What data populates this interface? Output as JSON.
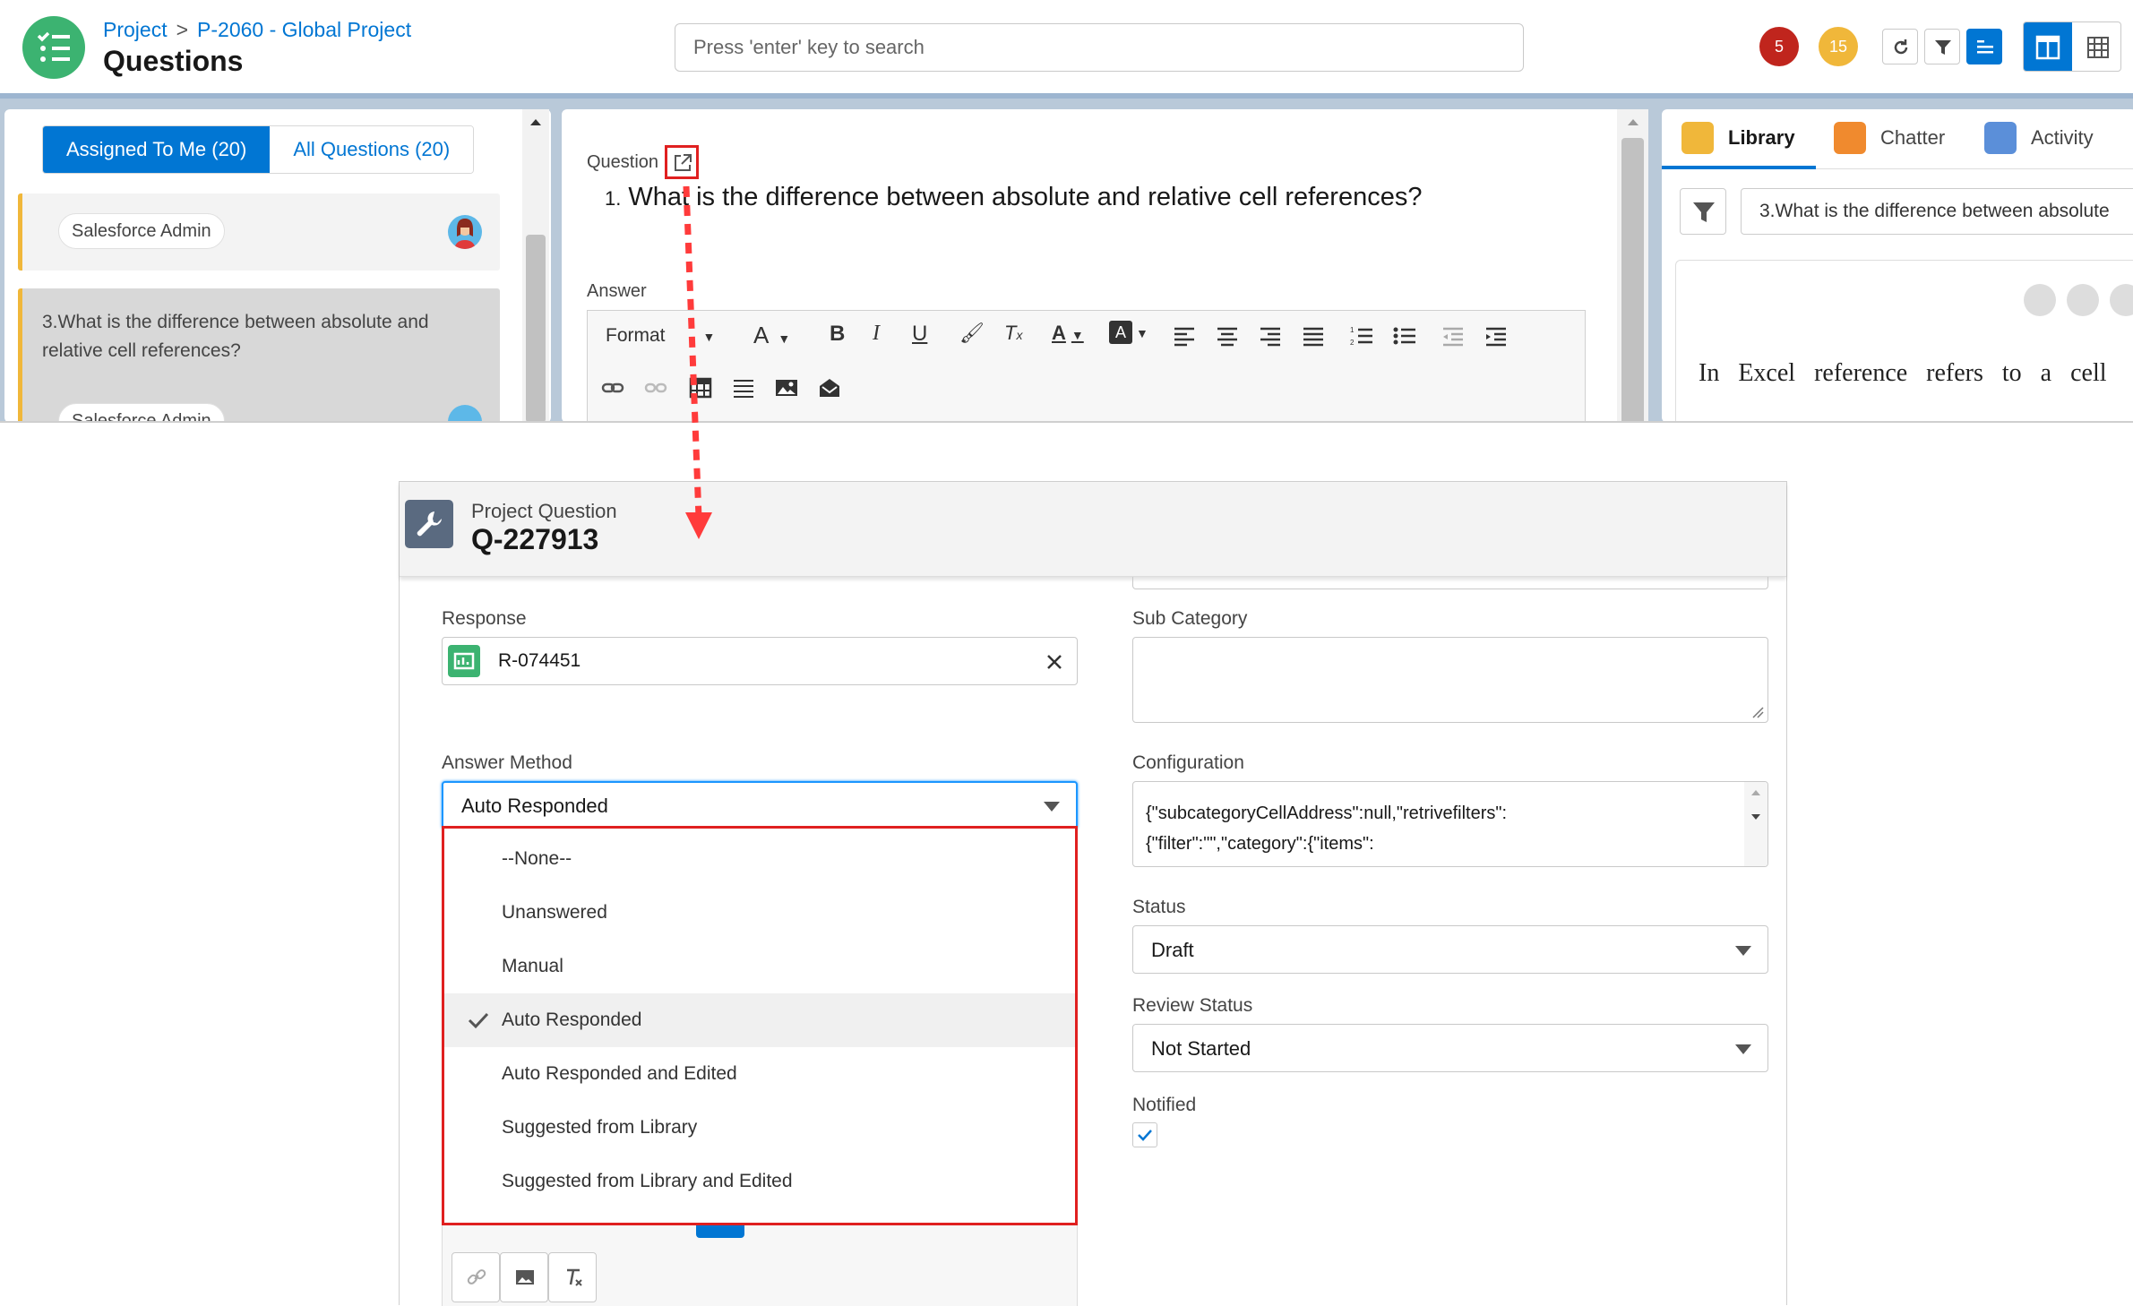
{
  "header": {
    "breadcrumb": [
      "Project",
      "P-2060 - Global Project"
    ],
    "breadcrumb_sep": ">",
    "title": "Questions",
    "search_placeholder": "Press 'enter' key to search",
    "badge_red": "5",
    "badge_yellow": "15"
  },
  "left_panel": {
    "tabs": [
      {
        "label": "Assigned To Me (20)",
        "active": true
      },
      {
        "label": "All Questions (20)",
        "active": false
      }
    ],
    "cards": [
      {
        "pill": "Salesforce Admin",
        "text": ""
      },
      {
        "text": "3.What is the difference between absolute and relative cell references?",
        "pill": "Salesforce Admin"
      }
    ]
  },
  "mid_panel": {
    "question_label": "Question",
    "question_number": "1.",
    "question_text": "What is the difference between absolute and relative cell references?",
    "answer_label": "Answer",
    "toolbar_format": "Format",
    "toolbar_font": "A"
  },
  "right_panel": {
    "tabs": [
      {
        "label": "Library",
        "active": true,
        "color": "#f0b73a"
      },
      {
        "label": "Chatter",
        "active": false,
        "color": "#f08a2e"
      },
      {
        "label": "Activity",
        "active": false,
        "color": "#5b8fd9"
      }
    ],
    "search_value": "3.What is the difference between absolute",
    "content_text": "In Excel reference refers to a cell"
  },
  "modal": {
    "object_label": "Project Question",
    "record_name": "Q-227913",
    "response_label": "Response",
    "response_value": "R-074451",
    "sub_category_label": "Sub Category",
    "sub_category_value": "",
    "answer_method_label": "Answer Method",
    "answer_method_value": "Auto Responded",
    "answer_method_options": [
      {
        "label": "--None--",
        "selected": false
      },
      {
        "label": "Unanswered",
        "selected": false
      },
      {
        "label": "Manual",
        "selected": false
      },
      {
        "label": "Auto Responded",
        "selected": true
      },
      {
        "label": "Auto Responded and Edited",
        "selected": false
      },
      {
        "label": "Suggested from Library",
        "selected": false
      },
      {
        "label": "Suggested from Library and Edited",
        "selected": false
      }
    ],
    "configuration_label": "Configuration",
    "configuration_lines": [
      "{\"subcategoryCellAddress\":null,\"retrivefilters\":",
      "{\"filter\":\"\",\"category\":{\"items\":"
    ],
    "status_label": "Status",
    "status_value": "Draft",
    "review_status_label": "Review Status",
    "review_status_value": "Not Started",
    "notified_label": "Notified",
    "notified_checked": true
  },
  "colors": {
    "brand_blue": "#0176d3",
    "highlight_red": "#e02020",
    "app_green": "#3cb371"
  }
}
